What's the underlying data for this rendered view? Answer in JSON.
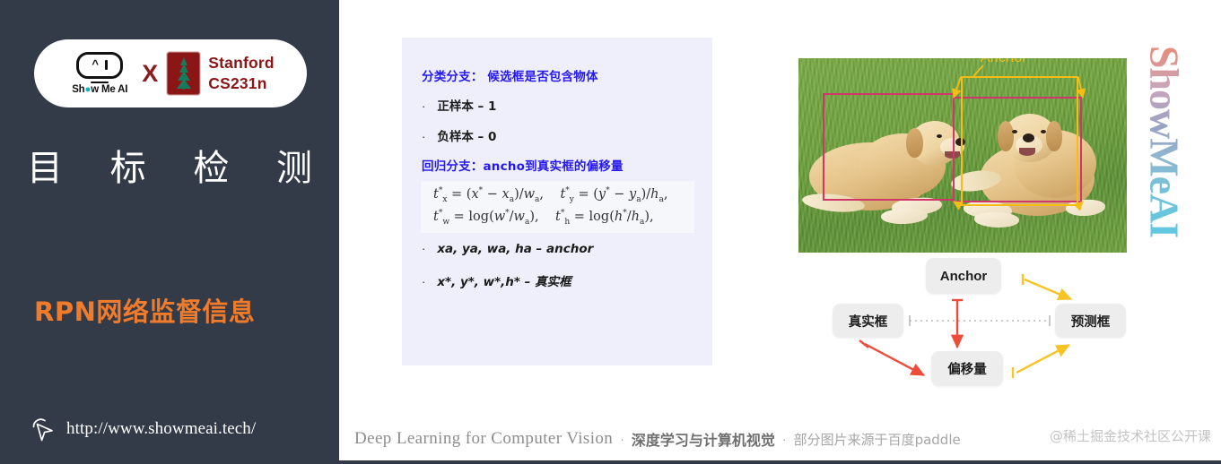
{
  "sidebar": {
    "brand": {
      "showmeai_word": "Show Me AI",
      "cross": "X",
      "stanford_line1": "Stanford",
      "stanford_line2": "CS231n"
    },
    "title_chars": [
      "目",
      "标",
      "检",
      "测"
    ],
    "subtitle": "RPN网络监督信息",
    "url": "http://www.showmeai.tech/",
    "cursor_icon": "cursor-pointer-icon",
    "bg_color": "#343b48",
    "accent_color": "#f07b2a"
  },
  "content": {
    "panel": {
      "heading_classification": "分类分支： 候选框是否包含物体",
      "bullets_top": [
        {
          "dot": "·",
          "text": "正样本 – 1"
        },
        {
          "dot": "·",
          "text": "负样本 – 0"
        }
      ],
      "heading_regression": "回归分支：ancho到真实框的偏移量",
      "formula_line1": "t*x = (x* − xa)/wa,    t*y = (y* − ya)/ha,",
      "formula_line2": "t*w = log(w*/wa),    t*h = log(h*/ha),",
      "bullets_bottom": [
        {
          "dot": "·",
          "text": "xa, ya, wa, ha – anchor"
        },
        {
          "dot": "·",
          "text": "x*, y*, w*,h* – 真实框"
        }
      ],
      "bg_color": "#eeeffb",
      "heading_color": "#2518f0"
    },
    "photo": {
      "alt": "two-golden-retrievers-on-grass",
      "anchor_label": "Anchor",
      "anchor_box_color": "#f5bd16",
      "groundtruth_box_color": "#d1366b"
    },
    "flow": {
      "anchor": "Anchor",
      "ground_truth": "真实框",
      "prediction": "预测框",
      "offset": "偏移量",
      "red_arrow_color": "#ee4b3b",
      "yellow_arrow_color": "#f7c325"
    },
    "vertical_logo": "ShowMeAI"
  },
  "footer": {
    "english": "Deep Learning for Computer Vision",
    "sep1": "·",
    "chinese_bold": "深度学习与计算机视觉",
    "sep2": "·",
    "chinese_note": "部分图片来源于百度paddle",
    "watermark": "@稀土掘金技术社区公开课"
  }
}
